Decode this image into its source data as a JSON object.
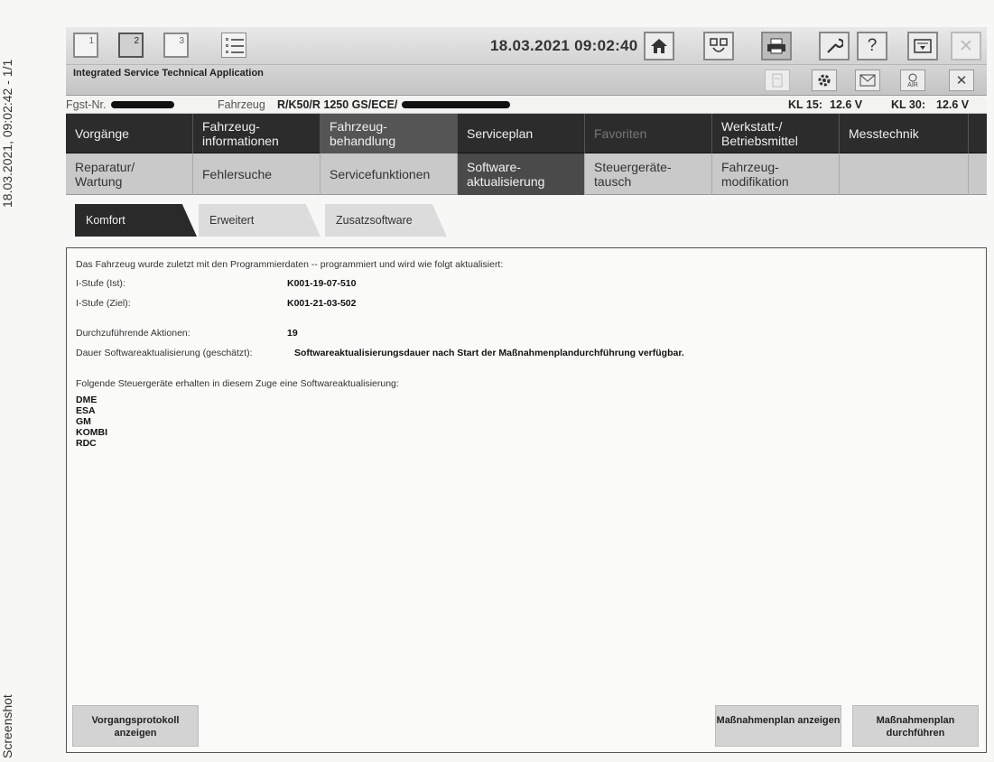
{
  "margin": {
    "timestamp": "18.03.2021, 09:02:42 - 1/1",
    "label": "Screenshot"
  },
  "topbar": {
    "window_numbers": [
      "1",
      "2",
      "3"
    ],
    "active_window": "2",
    "datetime": "18.03.2021 09:02:40",
    "icons": [
      "home-icon",
      "connection-icon",
      "printer-icon",
      "wrench-icon",
      "help-icon",
      "minimize-icon",
      "close-icon"
    ],
    "help_label": "?",
    "close_label": "✕"
  },
  "titlebar": {
    "app_title": "Integrated Service Technical Application",
    "icons": [
      "page-icon",
      "settings-icon",
      "mail-icon",
      "air-icon",
      "close-icon"
    ],
    "air_label": "AIR",
    "close_label": "✕"
  },
  "vehicle": {
    "fgst_label": "Fgst-Nr.",
    "fahrzeug_label": "Fahrzeug",
    "fahrzeug_value": "R/K50/R 1250 GS/ECE/",
    "kl15_label": "KL 15:",
    "kl15_value": "12.6 V",
    "kl30_label": "KL 30:",
    "kl30_value": "12.6 V"
  },
  "menu": [
    {
      "label": "Vorgänge"
    },
    {
      "label": "Fahrzeug-informationen"
    },
    {
      "label": "Fahrzeug-behandlung"
    },
    {
      "label": "Serviceplan"
    },
    {
      "label": "Favoriten"
    },
    {
      "label": "Werkstatt-/ Betriebsmittel"
    },
    {
      "label": "Messtechnik"
    }
  ],
  "submenu": [
    {
      "label": "Reparatur/ Wartung"
    },
    {
      "label": "Fehlersuche"
    },
    {
      "label": "Servicefunktionen"
    },
    {
      "label": "Software-aktualisierung"
    },
    {
      "label": "Steuergeräte-tausch"
    },
    {
      "label": "Fahrzeug-modifikation"
    }
  ],
  "tabs": [
    {
      "label": "Komfort"
    },
    {
      "label": "Erweitert"
    },
    {
      "label": "Zusatzsoftware"
    }
  ],
  "content": {
    "intro": "Das Fahrzeug wurde zuletzt mit den Programmierdaten -- programmiert und wird wie folgt aktualisiert:",
    "istufe_ist_label": "I-Stufe (Ist):",
    "istufe_ist_value": "K001-19-07-510",
    "istufe_ziel_label": "I-Stufe (Ziel):",
    "istufe_ziel_value": "K001-21-03-502",
    "actions_label": "Durchzuführende Aktionen:",
    "actions_value": "19",
    "duration_label": "Dauer Softwareaktualisierung (geschätzt):",
    "duration_value": "Softwareaktualisierungsdauer nach Start der Maßnahmenplandurchführung verfügbar.",
    "ecu_intro": "Folgende Steuergeräte erhalten in diesem Zuge eine Softwareaktualisierung:",
    "ecus": [
      "DME",
      "ESA",
      "GM",
      "KOMBI",
      "RDC"
    ]
  },
  "buttons": {
    "protocol": "Vorgangsprotokoll anzeigen",
    "plan_show": "Maßnahmenplan anzeigen",
    "plan_run": "Maßnahmenplan durchführen"
  }
}
